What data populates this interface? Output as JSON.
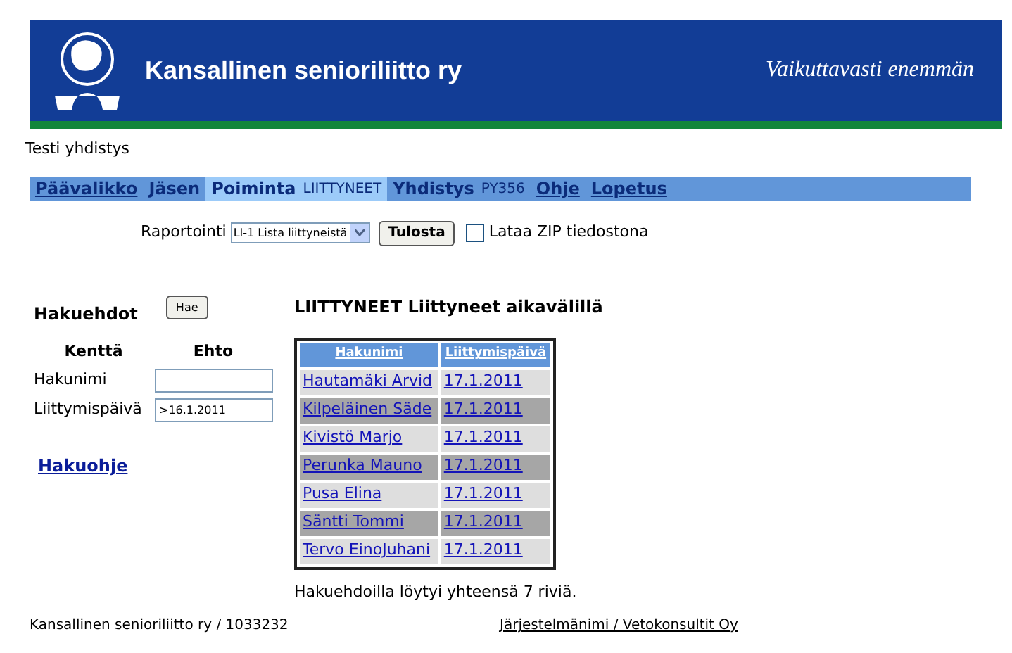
{
  "banner": {
    "title": "Kansallinen senioriliitto ry",
    "slogan": "Vaikuttavasti enemmän"
  },
  "organization": "Testi yhdistys",
  "nav": [
    {
      "label": "Päävalikko",
      "kind": "link",
      "selected": false
    },
    {
      "label": "Jäsen",
      "kind": "section",
      "selected": false
    },
    {
      "label": "Poiminta",
      "kind": "section",
      "selected": true,
      "sub": "LIITTYNEET"
    },
    {
      "label": "Yhdistys",
      "kind": "section",
      "selected": false,
      "sub": "PY356"
    },
    {
      "label": "Ohje",
      "kind": "link",
      "selected": false
    },
    {
      "label": "Lopetus",
      "kind": "link",
      "selected": false
    }
  ],
  "report": {
    "label": "Raportointi",
    "select": "LI-1 Lista liittyneistä",
    "button": "Tulosta",
    "zip": {
      "label": "Lataa ZIP tiedostona",
      "checked": false
    }
  },
  "criteria": {
    "title": "Hakuehdot",
    "button": "Hae",
    "columns": [
      "Kenttä",
      "Ehto"
    ],
    "fields": [
      {
        "label": "Hakunimi"
      },
      {
        "label": "Liittymispäivä",
        "value": ">16.1.2011"
      }
    ],
    "help_link": "Hakuohje"
  },
  "results": {
    "title": "LIITTYNEET Liittyneet aikavälillä",
    "columns": [
      "Hakunimi",
      "Liittymispäivä"
    ],
    "rows": [
      [
        "Hautamäki Arvid",
        "17.1.2011"
      ],
      [
        "Kilpeläinen Säde",
        "17.1.2011"
      ],
      [
        "Kivistö Marjo",
        "17.1.2011"
      ],
      [
        "Perunka Mauno",
        "17.1.2011"
      ],
      [
        "Pusa Elina",
        "17.1.2011"
      ],
      [
        "Säntti Tommi",
        "17.1.2011"
      ],
      [
        "Tervo EinoJuhani",
        "17.1.2011"
      ]
    ],
    "summary": "Hakuehdoilla löytyi yhteensä 7 riviä."
  },
  "footer": {
    "left": "Kansallinen senioriliitto ry / 1033232",
    "right": "Järjestelmänimi / Vetokonsultit Oy"
  }
}
